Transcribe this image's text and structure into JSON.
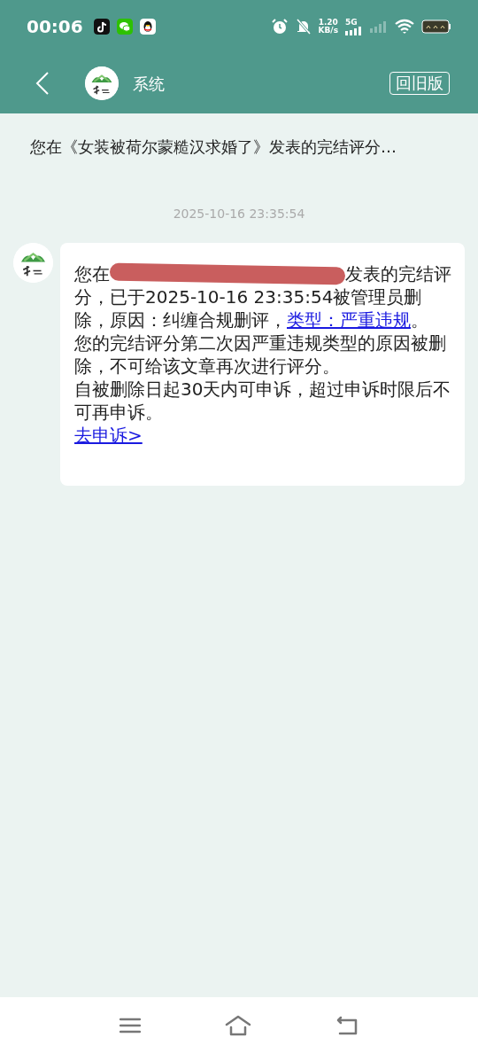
{
  "status_bar": {
    "time": "00:06",
    "apps": [
      {
        "kind": "tiktok"
      },
      {
        "kind": "wechat"
      },
      {
        "kind": "qq"
      }
    ],
    "net_speed": "1.20",
    "net_unit": "KB/s",
    "network": "5G"
  },
  "header": {
    "title": "系统",
    "button": "回旧版"
  },
  "notice": "您在《女装被荷尔蒙糙汉求婚了》发表的完结评分…",
  "timestamp": "2025-10-16 23:35:54",
  "message": {
    "paragraphs": [
      {
        "segments": [
          {
            "kind": "text",
            "text": "您在"
          },
          {
            "kind": "redacted"
          },
          {
            "kind": "text",
            "text": "发表的完结评分，已于2025-10-16 23:35:54被管理员删除，原因：纠缠合规删评，"
          },
          {
            "kind": "link",
            "text": "类型：严重违规"
          },
          {
            "kind": "text",
            "text": "。"
          }
        ]
      },
      {
        "segments": [
          {
            "kind": "text",
            "text": "您的完结评分第二次因严重违规类型的原因被删除，不可给该文章再次进行评分。"
          }
        ]
      },
      {
        "segments": [
          {
            "kind": "text",
            "text": "自被删除日起30天内可申诉，超过申诉时限后不可再申诉。"
          }
        ]
      },
      {
        "segments": [
          {
            "kind": "link",
            "text": "去申诉>"
          }
        ]
      }
    ]
  }
}
